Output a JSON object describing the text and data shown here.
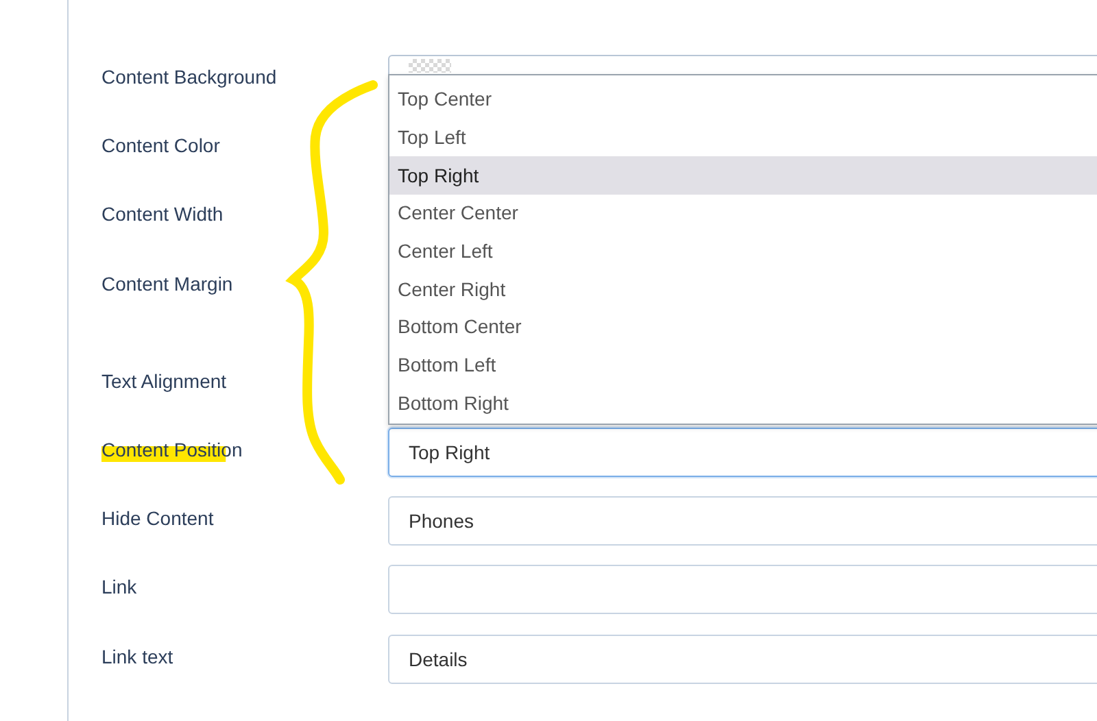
{
  "form": {
    "fields": [
      {
        "label": "Content Background",
        "kind": "color"
      },
      {
        "label": "Content Color"
      },
      {
        "label": "Content Width"
      },
      {
        "label": "Content Margin"
      },
      {
        "label": "Text Alignment"
      },
      {
        "label": "Content Position",
        "kind": "select",
        "value": "Top Right",
        "expanded": true,
        "focused": true,
        "options": [
          {
            "label": "Top Center",
            "selected": false
          },
          {
            "label": "Top Left",
            "selected": false
          },
          {
            "label": "Top Right",
            "selected": true
          },
          {
            "label": "Center Center",
            "selected": false
          },
          {
            "label": "Center Left",
            "selected": false
          },
          {
            "label": "Center Right",
            "selected": false
          },
          {
            "label": "Bottom Center",
            "selected": false
          },
          {
            "label": "Bottom Left",
            "selected": false
          },
          {
            "label": "Bottom Right",
            "selected": false
          }
        ]
      },
      {
        "label": "Hide Content",
        "kind": "select",
        "value": "Phones"
      },
      {
        "label": "Link",
        "kind": "text"
      },
      {
        "label": "Link text",
        "kind": "text",
        "value": "Details"
      }
    ]
  }
}
